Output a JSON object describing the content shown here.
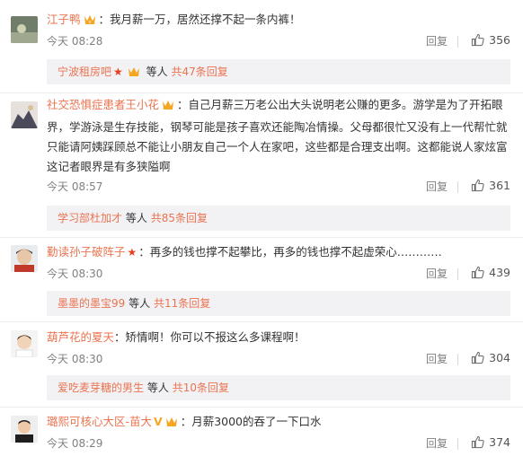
{
  "comments": [
    {
      "username": "江子鸭",
      "text": "：我月薪一万，居然还撑不起一条内裤！",
      "time": "今天 08:28",
      "reply_label": "回复",
      "likes": "356",
      "replies_summary": {
        "user": "宁波租房吧",
        "others": "等人",
        "count": "共47条回复"
      }
    },
    {
      "username": "社交恐惧症患者王小花",
      "text": "：自己月薪三万老公出大头说明老公赚的更多。游学是为了开拓眼界，学游泳是生存技能，钢琴可能是孩子喜欢还能陶冶情操。父母都很忙又没有上一代帮忙就只能请阿姨踩顾总不能让小朋友自己一个人在家吧，这些都是合理支出啊。这都能说人家炫富这记者眼界是有多狭隘啊",
      "time": "今天 08:57",
      "reply_label": "回复",
      "likes": "361",
      "replies_summary": {
        "user": "学习部杜加才",
        "others": "等人",
        "count": "共85条回复"
      }
    },
    {
      "username": "勤读孙子破阵子",
      "text": "：再多的钱也撑不起攀比，再多的钱也撑不起虚荣心…………",
      "time": "今天 08:30",
      "reply_label": "回复",
      "likes": "439",
      "replies_summary": {
        "user": "墨墨的墨宝99",
        "others": "等人",
        "count": "共11条回复"
      }
    },
    {
      "username": "葫芦花的夏天",
      "text": "：矫情啊！你可以不报这么多课程啊！",
      "time": "今天 08:30",
      "reply_label": "回复",
      "likes": "304",
      "replies_summary": {
        "user": "爱吃麦芽糖的男生",
        "others": "等人",
        "count": "共10条回复"
      }
    },
    {
      "username": "璐熙可核心大区-苗大",
      "text": "：月薪3000的吞了一下口水",
      "time": "今天 08:29",
      "reply_label": "回复",
      "likes": "374"
    }
  ],
  "colors": {
    "username": "#eb7350",
    "meta": "#808080",
    "subbox_bg": "#f2f2f5"
  }
}
